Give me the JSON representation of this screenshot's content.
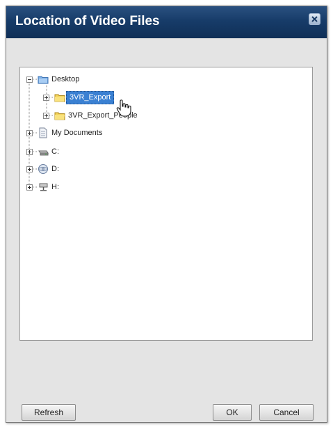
{
  "dialog": {
    "title": "Location of Video Files",
    "close_icon": "close-icon"
  },
  "tree": {
    "nodes": [
      {
        "label": "Desktop",
        "icon": "desktop-folder-icon",
        "expanded": true
      },
      {
        "label": "3VR_Export",
        "icon": "folder-icon",
        "selected": true
      },
      {
        "label": "3VR_Export_People",
        "icon": "folder-icon"
      },
      {
        "label": "My Documents",
        "icon": "documents-icon"
      },
      {
        "label": "C:",
        "icon": "hard-drive-icon"
      },
      {
        "label": "D:",
        "icon": "cd-drive-icon"
      },
      {
        "label": "H:",
        "icon": "network-drive-icon"
      }
    ]
  },
  "buttons": {
    "refresh": "Refresh",
    "ok": "OK",
    "cancel": "Cancel"
  }
}
